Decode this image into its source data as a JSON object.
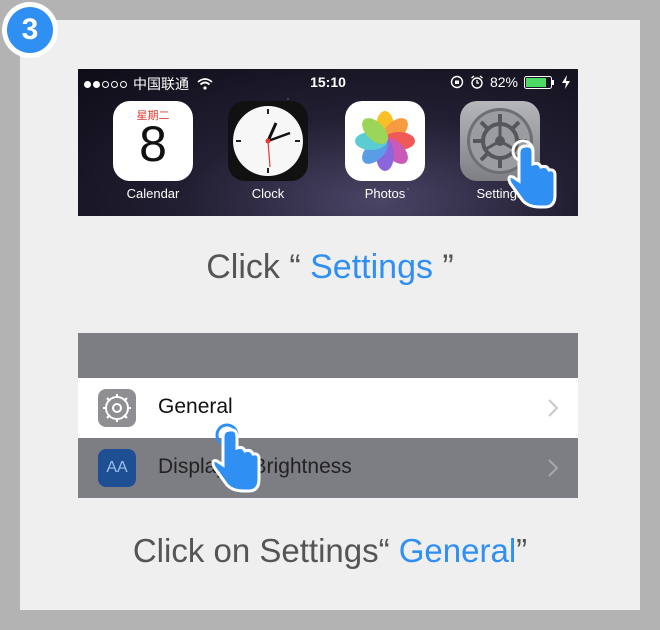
{
  "step": {
    "number": "3"
  },
  "status_bar": {
    "carrier": "中国联通",
    "time": "15:10",
    "battery": "82%"
  },
  "apps": [
    {
      "label": "Calendar",
      "weekday": "星期二",
      "date": "8"
    },
    {
      "label": "Clock"
    },
    {
      "label": "Photos"
    },
    {
      "label": "Settings"
    }
  ],
  "caption1": {
    "prefix": "Click “ ",
    "highlight": "Settings",
    "suffix": " ”"
  },
  "settings_list": {
    "rows": [
      {
        "label": "General",
        "icon": "gear-icon"
      },
      {
        "label": "Display & Brightness",
        "icon": "display-brightness-icon",
        "icon_text": "AA"
      }
    ]
  },
  "caption2": {
    "prefix": "Click on Settings“ ",
    "highlight": "General",
    "suffix": "”"
  },
  "colors": {
    "accent": "#2f8ff2",
    "caption_gray": "#555555",
    "card_bg": "#efefef"
  }
}
